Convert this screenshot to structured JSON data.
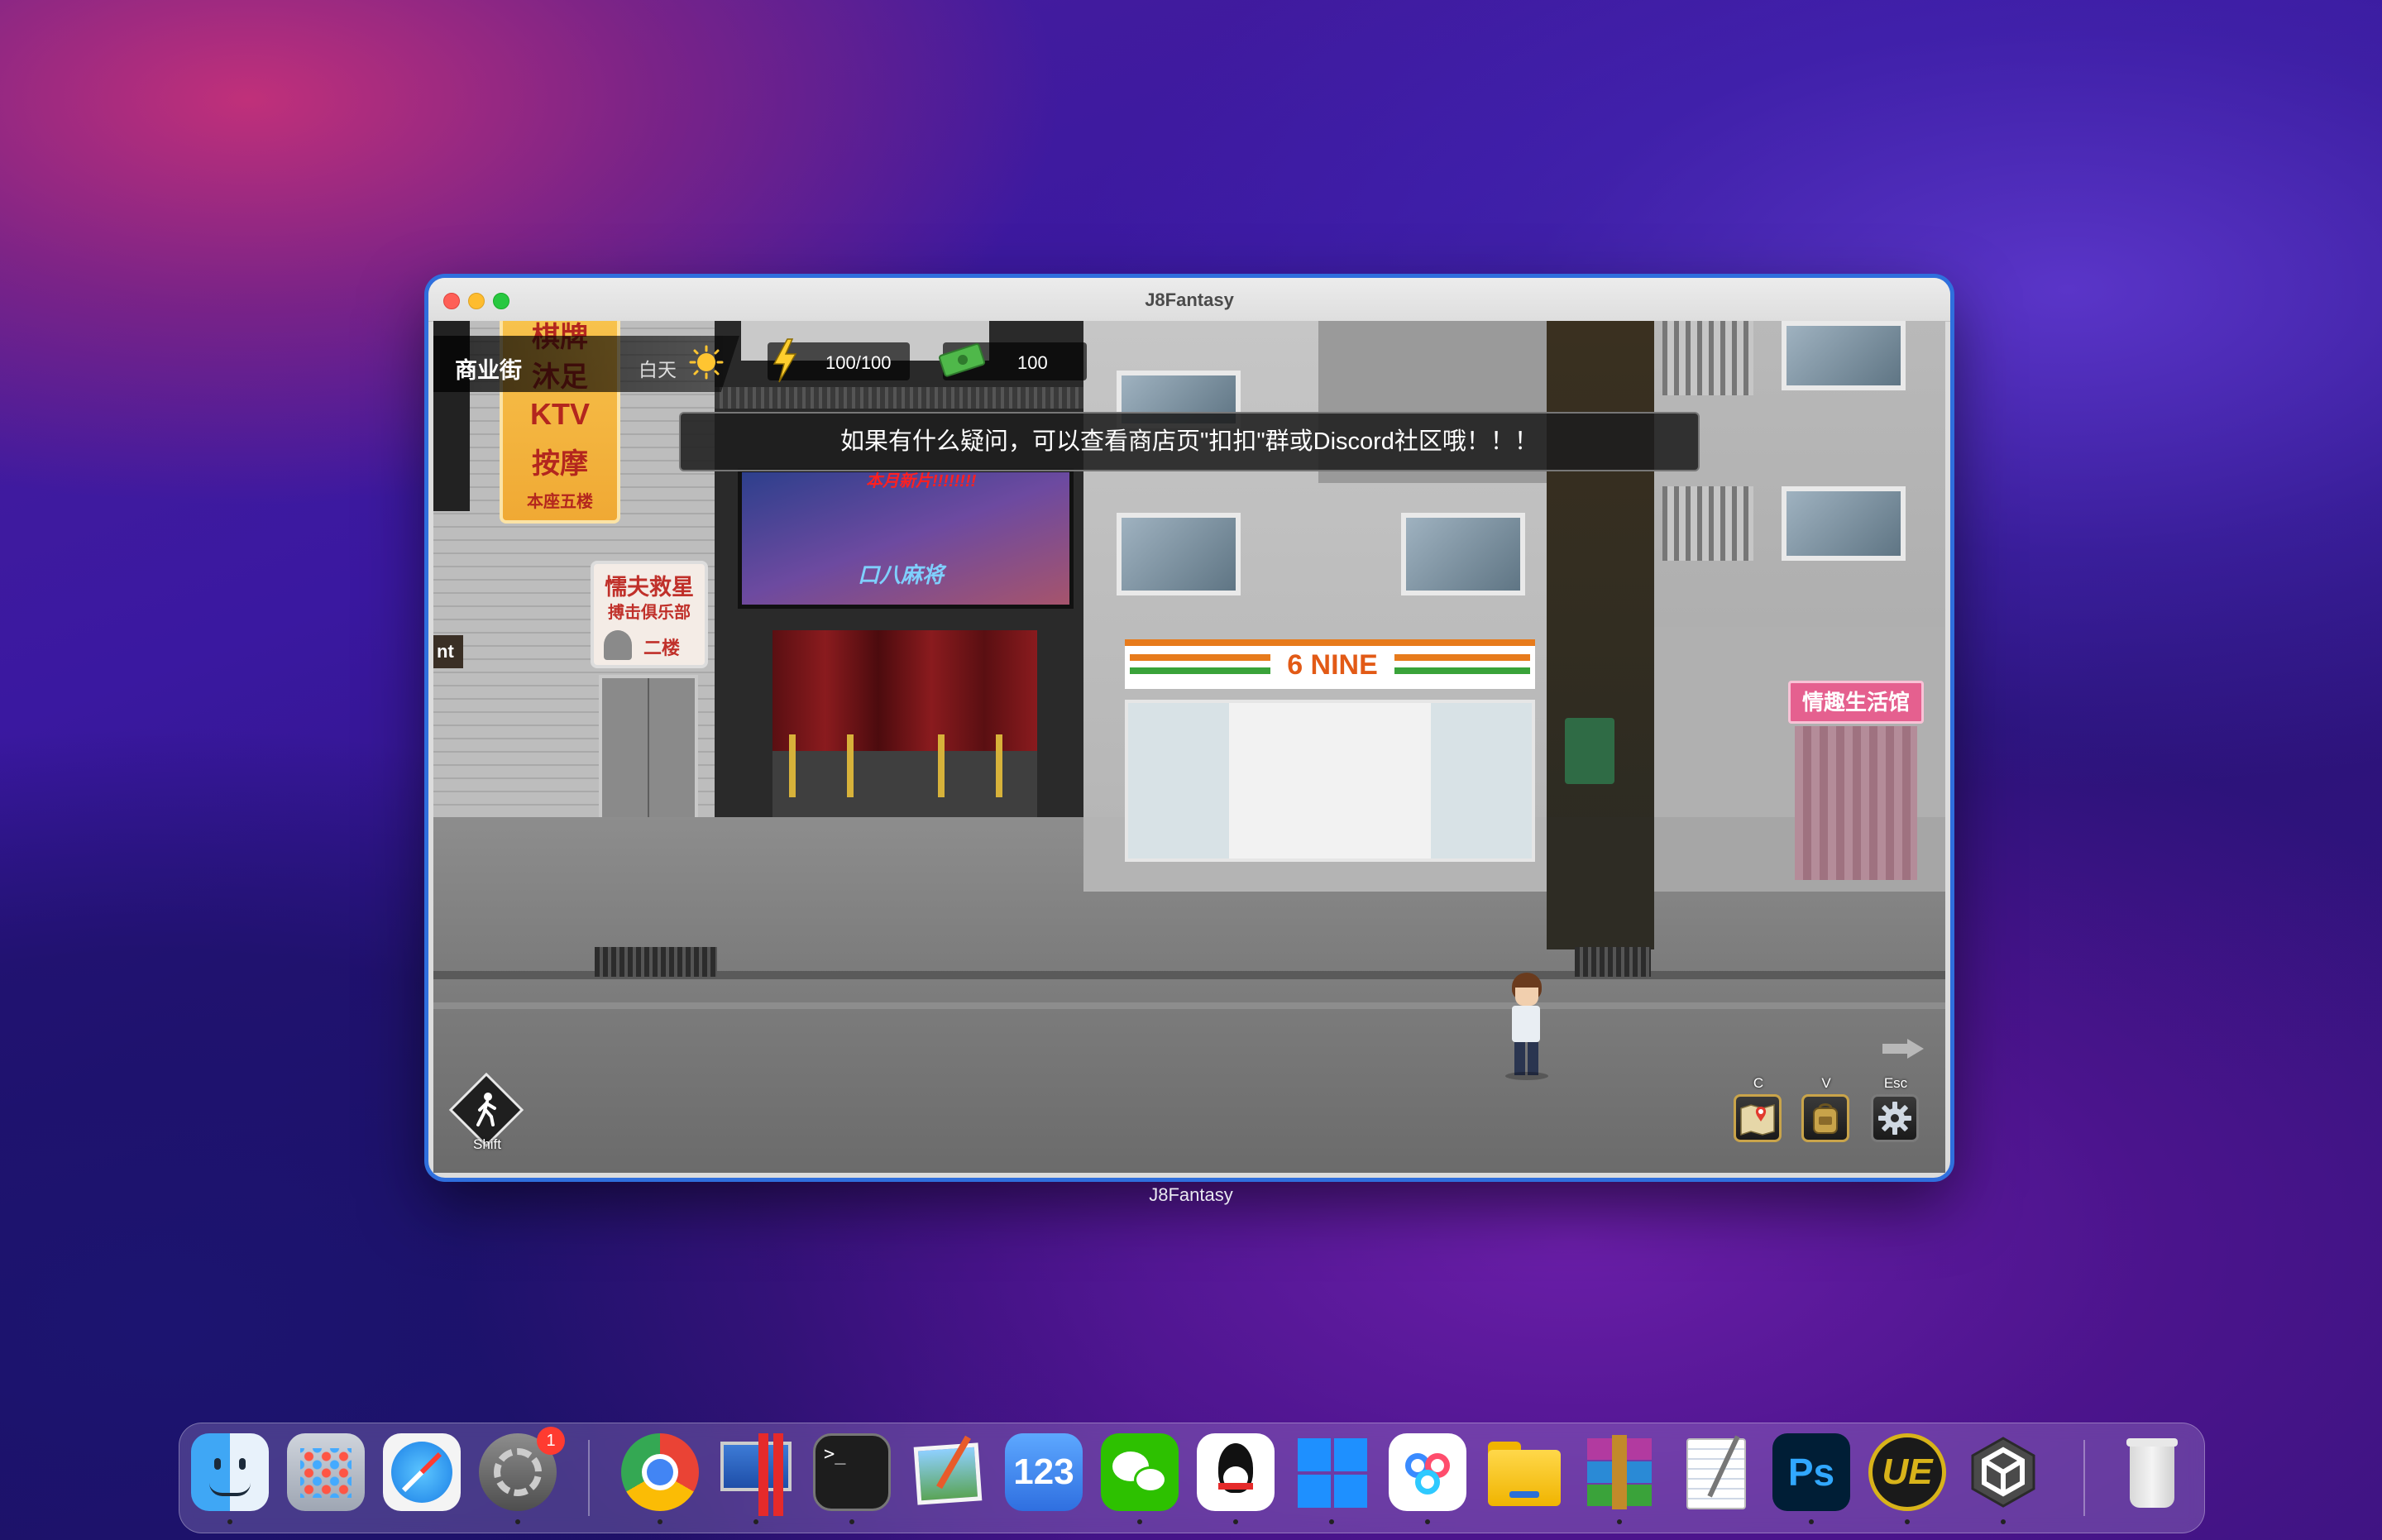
{
  "window": {
    "title": "J8Fantasy",
    "caption": "J8Fantasy"
  },
  "hud": {
    "location": "商业街",
    "time_of_day": "白天",
    "energy": "100/100",
    "money": "100"
  },
  "toast": "如果有什么疑问，可以查看商店页\"扣扣\"群或Discord社区哦！！！",
  "signs": {
    "vertical": [
      "棋牌",
      "沐足",
      "KTV",
      "按摩"
    ],
    "vertical_floor": "本座五楼",
    "club_title": "懦夫救星",
    "club_sub": "搏击俱乐部",
    "club_floor": "二楼",
    "left_edge": "nt",
    "billboard_top": "本月新片!!!!!!!!",
    "billboard_title": "口八麻将",
    "store": "6 NINE",
    "shop": "情趣生活馆"
  },
  "controls": {
    "walk_key": "Shift",
    "map_key": "C",
    "bag_key": "V",
    "settings_key": "Esc"
  },
  "dock": {
    "items": [
      {
        "name": "Finder",
        "icon": "finder-icon"
      },
      {
        "name": "Launchpad",
        "icon": "launchpad-icon"
      },
      {
        "name": "Safari",
        "icon": "safari-icon"
      },
      {
        "name": "System Preferences",
        "icon": "settings-icon",
        "badge": "1"
      },
      {
        "name": "Google Chrome",
        "icon": "chrome-icon"
      },
      {
        "name": "Parallels Desktop",
        "icon": "parallels-icon"
      },
      {
        "name": "Terminal",
        "icon": "terminal-icon"
      },
      {
        "name": "Preview",
        "icon": "preview-icon"
      },
      {
        "name": "Numbers",
        "icon": "numbers-icon",
        "label": "123"
      },
      {
        "name": "WeChat",
        "icon": "wechat-icon"
      },
      {
        "name": "QQ",
        "icon": "qq-icon"
      },
      {
        "name": "Windows App",
        "icon": "windows-icon"
      },
      {
        "name": "Baidu Netdisk",
        "icon": "baidu-icon"
      },
      {
        "name": "Files",
        "icon": "folder-icon"
      },
      {
        "name": "WinRAR",
        "icon": "winrar-icon"
      },
      {
        "name": "TextEdit",
        "icon": "textedit-icon"
      },
      {
        "name": "Photoshop",
        "icon": "photoshop-icon",
        "label": "Ps"
      },
      {
        "name": "Unreal Engine",
        "icon": "unreal-icon",
        "label": "UE"
      },
      {
        "name": "Unity",
        "icon": "unity-icon"
      },
      {
        "name": "Trash",
        "icon": "trash-icon"
      }
    ]
  }
}
